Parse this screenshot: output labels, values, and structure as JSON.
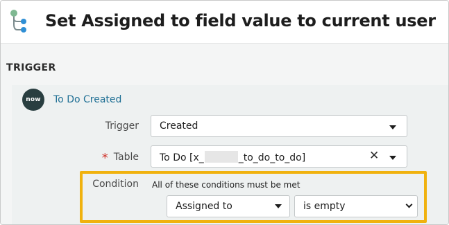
{
  "header": {
    "title": "Set Assigned to field value to current user",
    "icon": "flow-designer-icon"
  },
  "section": {
    "title": "TRIGGER"
  },
  "trigger": {
    "badge_text": "now",
    "badge_icon": "servicenow-icon",
    "link_label": "To Do Created",
    "trigger_label": "Trigger",
    "trigger_value": "Created",
    "table_label": "Table",
    "table_required_mark": "*",
    "table_value_prefix": "To Do [x_",
    "table_value_suffix": "_to_do_to_do]",
    "condition_label": "Condition",
    "condition_text": "All of these conditions must be met",
    "condition_field": "Assigned to",
    "condition_operator": "is empty"
  },
  "colors": {
    "highlight": "#f0b20f",
    "link": "#1f6f94",
    "required": "#d0372f",
    "badge": "#293e40"
  }
}
